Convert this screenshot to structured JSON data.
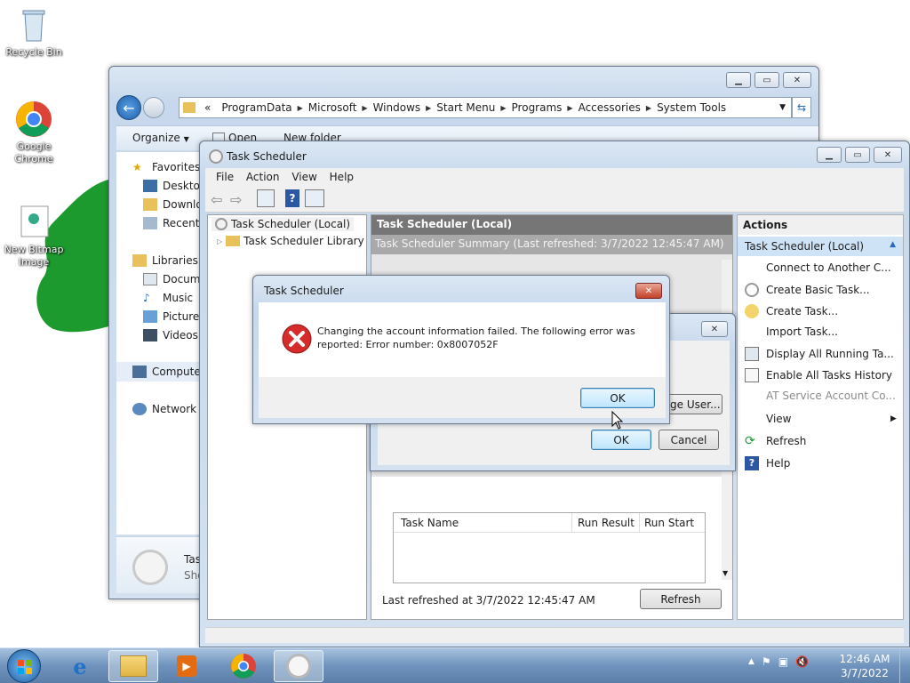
{
  "desktop": {
    "icons": [
      {
        "label": "Recycle Bin"
      },
      {
        "label": "Google Chrome"
      },
      {
        "label": "New Bitmap Image"
      }
    ]
  },
  "explorer": {
    "breadcrumb": [
      "«",
      "ProgramData",
      "Microsoft",
      "Windows",
      "Start Menu",
      "Programs",
      "Accessories",
      "System Tools"
    ],
    "toolbar": {
      "organize": "Organize",
      "open": "Open",
      "new_folder": "New folder"
    },
    "nav": {
      "favorites": "Favorites",
      "desktop": "Desktop",
      "downloads": "Downlo",
      "recent": "Recent P",
      "libraries": "Libraries",
      "documents": "Docume",
      "music": "Music",
      "pictures": "Pictures",
      "videos": "Videos",
      "computer": "Computer",
      "network": "Network"
    },
    "details": {
      "name": "Tas",
      "sub": "Sho"
    }
  },
  "task_scheduler": {
    "title": "Task Scheduler",
    "menu": [
      "File",
      "Action",
      "View",
      "Help"
    ],
    "tree": {
      "root": "Task Scheduler (Local)",
      "library": "Task Scheduler Library"
    },
    "center": {
      "header": "Task Scheduler (Local)",
      "summary": "Task Scheduler Summary (Last refreshed: 3/7/2022 12:45:47 AM)",
      "table_cols": [
        "Task Name",
        "Run Result",
        "Run Start"
      ],
      "last_refreshed": "Last refreshed at 3/7/2022 12:45:47 AM",
      "refresh_btn": "Refresh"
    },
    "actions": {
      "header": "Actions",
      "group": "Task Scheduler (Local)",
      "items": [
        "Connect to Another C...",
        "Create Basic Task...",
        "Create Task...",
        "Import Task...",
        "Display All Running Ta...",
        "Enable All Tasks History",
        "AT Service Account Co...",
        "View",
        "Refresh",
        "Help"
      ]
    }
  },
  "bg_dialog": {
    "change_user": "ge User...",
    "ok": "OK",
    "cancel": "Cancel"
  },
  "error_dialog": {
    "title": "Task Scheduler",
    "message_line1": "Changing the account information failed.  The following error was",
    "message_line2": "reported: Error number: 0x8007052F",
    "ok": "OK"
  },
  "taskbar": {
    "time": "12:46 AM",
    "date": "3/7/2022"
  }
}
